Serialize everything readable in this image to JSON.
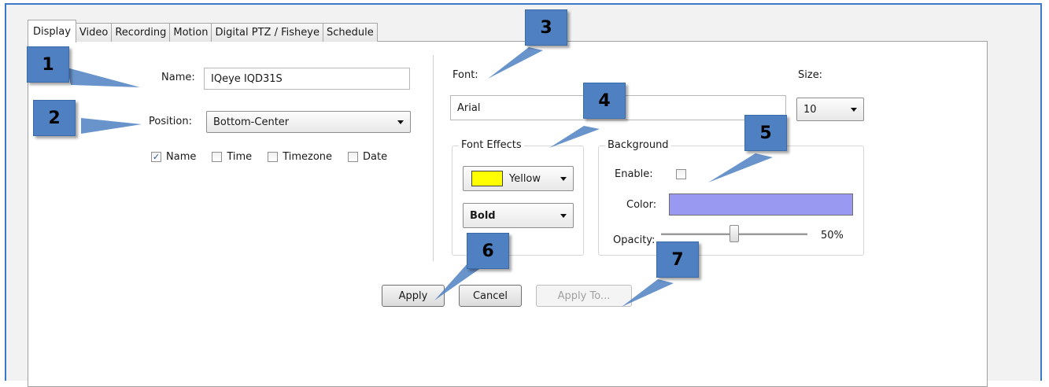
{
  "tabs": [
    {
      "label": "Display",
      "active": true
    },
    {
      "label": "Video"
    },
    {
      "label": "Recording"
    },
    {
      "label": "Motion"
    },
    {
      "label": "Digital PTZ / Fisheye"
    },
    {
      "label": "Schedule"
    }
  ],
  "overlay": {
    "name_label": "Name:",
    "name_value": "IQeye IQD31S",
    "position_label": "Position:",
    "position_value": "Bottom-Center",
    "checkboxes": [
      {
        "label": "Name",
        "checked": true
      },
      {
        "label": "Time",
        "checked": false
      },
      {
        "label": "Timezone",
        "checked": false
      },
      {
        "label": "Date",
        "checked": false
      }
    ]
  },
  "font": {
    "font_label": "Font:",
    "font_value": "Arial",
    "size_label": "Size:",
    "size_value": "10"
  },
  "font_effects": {
    "legend": "Font Effects",
    "color_value": "Yellow",
    "color_swatch": "#ffff00",
    "style_value": "Bold"
  },
  "background": {
    "legend": "Background",
    "enable_label": "Enable:",
    "enable_checked": false,
    "color_label": "Color:",
    "color_swatch": "#9999f2",
    "opacity_label": "Opacity:",
    "opacity_value": "50%",
    "opacity_fraction": 0.5
  },
  "buttons": {
    "apply": "Apply",
    "cancel": "Cancel",
    "apply_to": "Apply To..."
  },
  "callouts": [
    "1",
    "2",
    "3",
    "4",
    "5",
    "6",
    "7"
  ],
  "colors": {
    "frame_border": "#3c78c8",
    "callout_fill": "#4f80c2"
  }
}
